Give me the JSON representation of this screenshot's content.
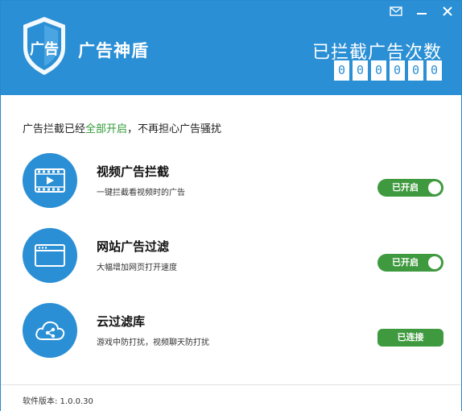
{
  "header": {
    "app_title": "广告神盾",
    "counter_label": "已拦截广告次数",
    "counter_digits": [
      "0",
      "0",
      "0",
      "0",
      "0",
      "0"
    ],
    "logo_text": "广告"
  },
  "window_controls": {
    "menu_icon": "mail-menu-icon",
    "minimize_icon": "minimize-icon",
    "close_icon": "close-icon"
  },
  "status": {
    "prefix": "广告拦截已经",
    "highlight": "全部开启",
    "suffix": "，不再担心广告骚扰"
  },
  "features": [
    {
      "title": "视频广告拦截",
      "desc": "一键拦截看视频时的广告",
      "icon": "video-icon",
      "control_label": "已开启"
    },
    {
      "title": "网站广告过滤",
      "desc": "大幅增加网页打开速度",
      "icon": "browser-window-icon",
      "control_label": "已开启"
    },
    {
      "title": "云过滤库",
      "desc": "游戏中防打扰，视频聊天防打扰",
      "icon": "cloud-share-icon",
      "control_label": "已连接"
    }
  ],
  "footer": {
    "version": "软件版本: 1.0.0.30"
  },
  "colors": {
    "header_blue": "#2a8fd5",
    "toggle_green": "#3f9a3f",
    "highlight_green": "#2e9a36"
  }
}
